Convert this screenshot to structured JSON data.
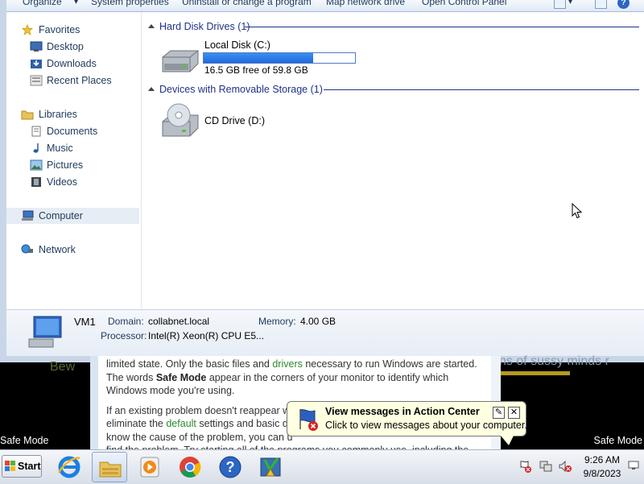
{
  "toolbar": {
    "items": [
      "Organize",
      "System properties",
      "Uninstall or change a program",
      "Map network drive",
      "Open Control Panel"
    ]
  },
  "nav": {
    "favorites": "Favorites",
    "desktop": "Desktop",
    "downloads": "Downloads",
    "recent_places": "Recent Places",
    "libraries": "Libraries",
    "documents": "Documents",
    "music": "Music",
    "pictures": "Pictures",
    "videos": "Videos",
    "computer": "Computer",
    "network": "Network"
  },
  "content": {
    "hdd_group": "Hard Disk Drives (1)",
    "local_disk_name": "Local Disk (C:)",
    "local_disk_free": "16.5 GB free of 59.8 GB",
    "local_disk_used_fraction": 0.724,
    "removable_group": "Devices with Removable Storage (1)",
    "cd_drive_name": "CD Drive (D:)"
  },
  "details": {
    "computer_name": "VM1",
    "domain_label": "Domain:",
    "domain_value": "collabnet.local",
    "memory_label": "Memory:",
    "memory_value": "4.00 GB",
    "processor_label": "Processor:",
    "processor_value": "Intel(R) Xeon(R) CPU E5..."
  },
  "background": {
    "left_fragment": "Bew",
    "right_fragment": "ns of sussy minds r",
    "help_p1_a": "limited state. Only the basic files and ",
    "help_p1_link": "drivers",
    "help_p1_b": " necessary to run Windows are started. The words ",
    "help_p1_bold": "Safe Mode",
    "help_p1_c": " appear in the corners of your monitor to identify which Windows mode you're using.",
    "help_p2_a": "If an existing problem doesn't reappear wh",
    "help_p2_b": "eliminate the ",
    "help_p2_link": "default",
    "help_p2_c": " settings and basic de",
    "help_p2_d": "know the cause of the problem, you can u",
    "help_p2_e": "find the problem. Try starting all of the programs you commonly use, including the",
    "safe_mode_left": "Safe Mode",
    "safe_mode_right": "Safe Mode"
  },
  "balloon": {
    "title": "View messages in Action Center",
    "message": "Click to view messages about your computer.",
    "pin_icon": "✎",
    "close_icon": "✕"
  },
  "taskbar": {
    "start_label": "Start",
    "apps": [
      "internet-explorer",
      "windows-explorer",
      "media-player",
      "chrome",
      "help-and-support",
      "action-center-app"
    ],
    "time": "9:26 AM",
    "date": "9/8/2023"
  }
}
